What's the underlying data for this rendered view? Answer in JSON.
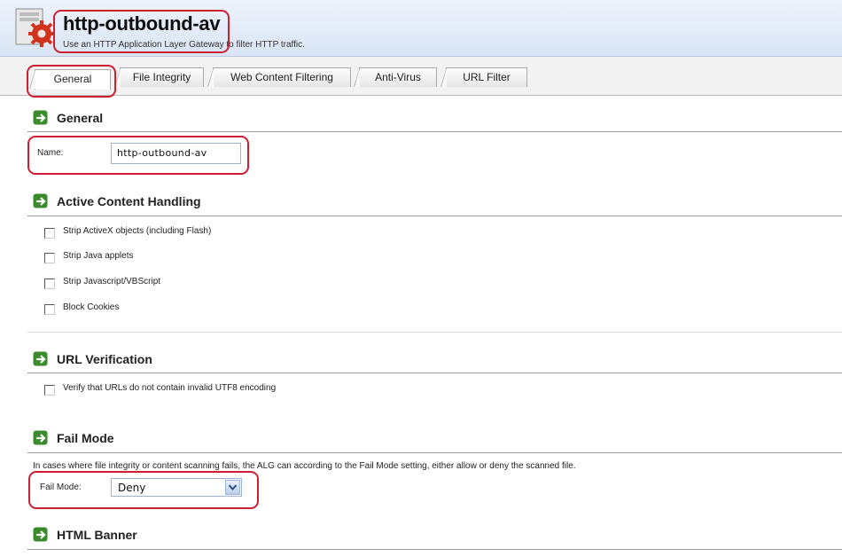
{
  "header": {
    "title": "http-outbound-av",
    "subtitle": "Use an HTTP Application Layer Gateway to filter HTTP traffic.",
    "icon": "alg-gear-icon"
  },
  "tabs": [
    {
      "label": "General",
      "active": true
    },
    {
      "label": "File Integrity",
      "active": false
    },
    {
      "label": "Web Content Filtering",
      "active": false
    },
    {
      "label": "Anti-Virus",
      "active": false
    },
    {
      "label": "URL Filter",
      "active": false
    }
  ],
  "sections": {
    "general": {
      "title": "General",
      "name_label": "Name:",
      "name_value": "http-outbound-av"
    },
    "active_content": {
      "title": "Active Content Handling",
      "options": [
        {
          "label": "Strip ActiveX objects (including Flash)",
          "checked": false
        },
        {
          "label": "Strip Java applets",
          "checked": false
        },
        {
          "label": "Strip Javascript/VBScript",
          "checked": false
        },
        {
          "label": "Block Cookies",
          "checked": false
        }
      ]
    },
    "url_verification": {
      "title": "URL Verification",
      "options": [
        {
          "label": "Verify that URLs do not contain invalid UTF8 encoding",
          "checked": false
        }
      ]
    },
    "fail_mode": {
      "title": "Fail Mode",
      "description": "In cases where file integrity or content scanning fails, the ALG can according to the Fail Mode setting, either allow or deny the scanned file.",
      "label": "Fail Mode:",
      "value": "Deny"
    },
    "html_banner": {
      "title": "HTML Banner"
    }
  },
  "colors": {
    "highlight": "#cc1f2f",
    "header_bg": "#d9e5f5",
    "section_icon": "#3c8a2e"
  }
}
